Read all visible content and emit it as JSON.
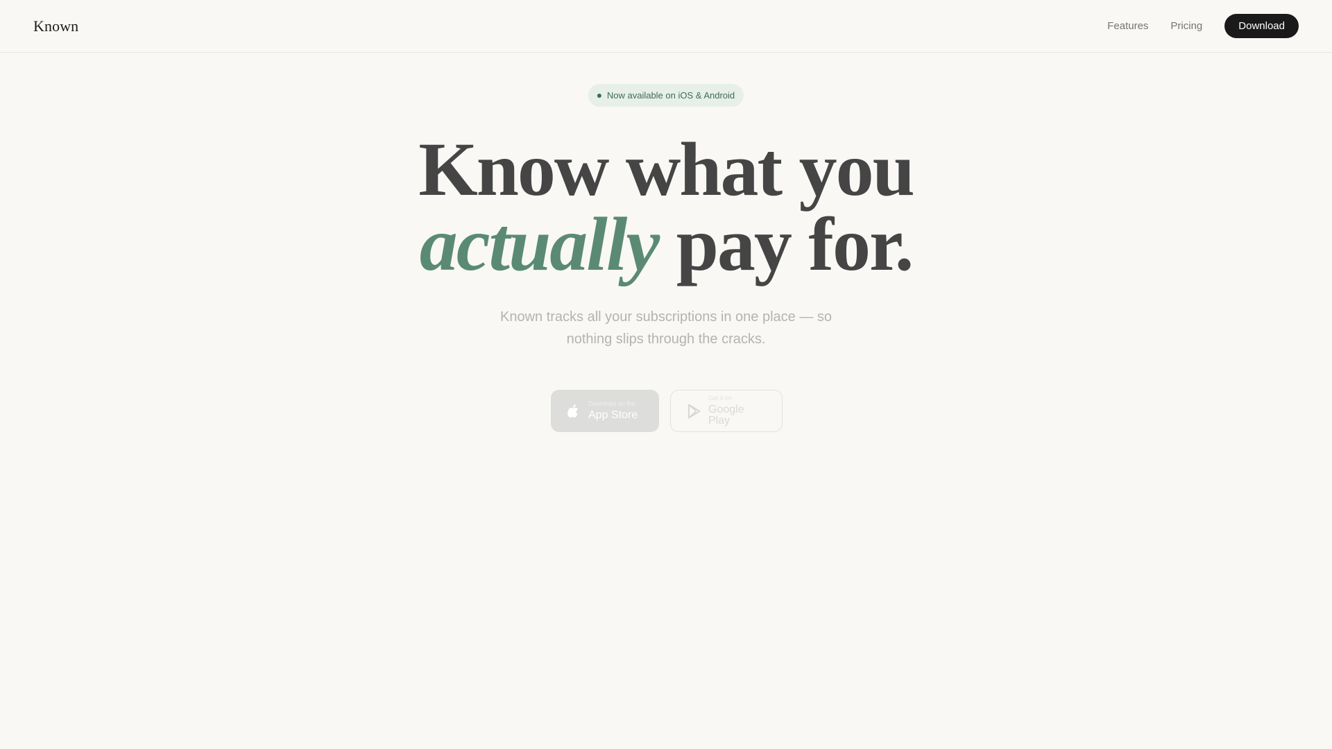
{
  "header": {
    "brand": "Known",
    "nav": [
      {
        "label": "Features"
      },
      {
        "label": "Pricing"
      }
    ],
    "download_label": "Download"
  },
  "hero": {
    "badge": "Now available on iOS & Android",
    "title_line1": "Know what you",
    "title_accent": "actually",
    "title_line2_rest": " pay for.",
    "subtitle": "Known tracks all your subscriptions in one place — so nothing slips through the cracks."
  },
  "stores": {
    "apple": {
      "small": "Download on the",
      "big": "App Store",
      "icon": "apple-icon"
    },
    "google": {
      "small": "Get it on",
      "big": "Google Play",
      "icon": "google-play-icon"
    }
  },
  "colors": {
    "background": "#f9f8f5",
    "accent": "#5b8a74",
    "heading": "#454545",
    "button_dark": "#1a1a1a"
  }
}
